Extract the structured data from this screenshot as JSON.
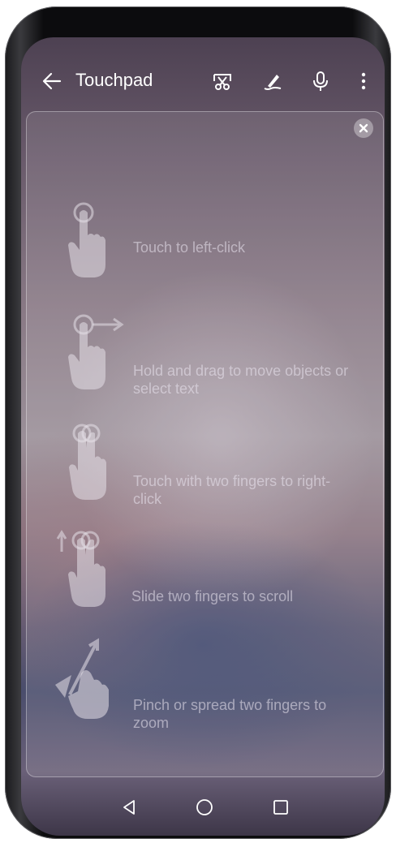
{
  "header": {
    "title": "Touchpad",
    "icons": [
      "back-arrow-icon",
      "screenshot-scissors-icon",
      "handwriting-pen-icon",
      "microphone-icon",
      "more-vertical-icon"
    ]
  },
  "gestures": [
    {
      "label": "Touch to left-click",
      "icon": "single-tap-hand-icon"
    },
    {
      "label": "Hold and drag to move objects or select text",
      "icon": "hold-drag-hand-icon"
    },
    {
      "label": "Touch with two fingers to right-click",
      "icon": "two-finger-tap-hand-icon"
    },
    {
      "label": "Slide two fingers to scroll",
      "icon": "two-finger-scroll-hand-icon"
    },
    {
      "label": "Pinch or spread two fingers to zoom",
      "icon": "pinch-zoom-hand-icon"
    }
  ],
  "navigation": {
    "icons": [
      "nav-back-triangle-icon",
      "nav-home-circle-icon",
      "nav-recents-square-icon"
    ]
  },
  "colors": {
    "text": "#ffffff",
    "hint_text": "#ebe6f0",
    "icon_fill": "#e6e0e8"
  }
}
